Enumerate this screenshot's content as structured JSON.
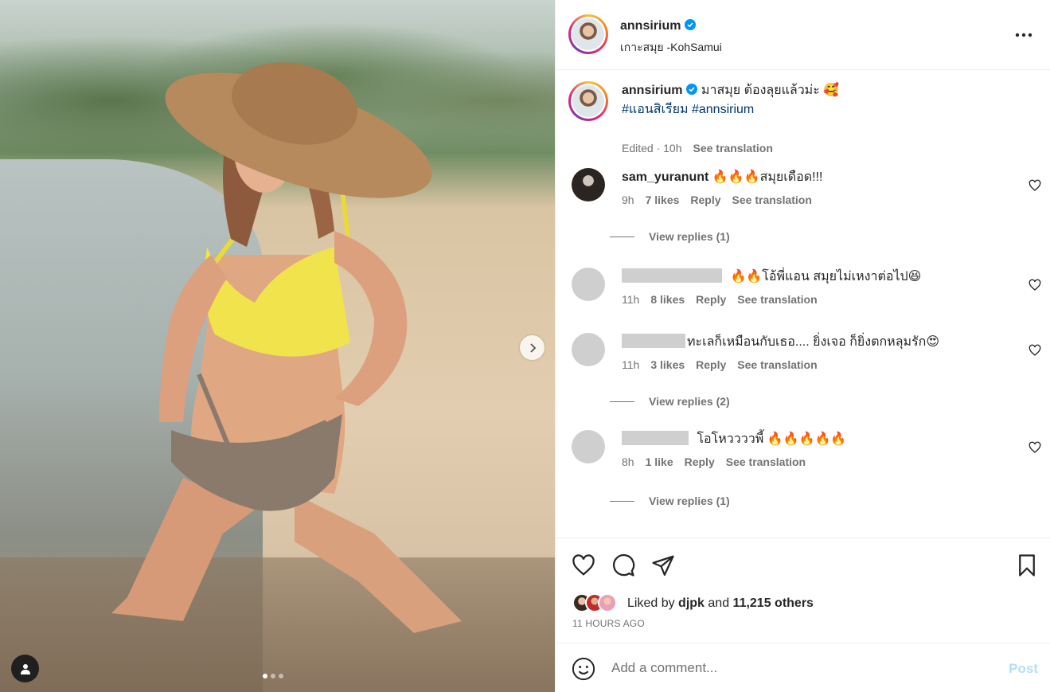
{
  "post": {
    "image_alt": "Woman in yellow bikini top and straw hat kneeling in shallow water on a beach",
    "carousel_dots": 3,
    "carousel_active": 0
  },
  "header": {
    "username": "annsirium",
    "location": "เกาะสมุย -KohSamui"
  },
  "caption": {
    "username": "annsirium",
    "text": "มาสมุย ต้องลุยแล้วม่ะ 🥰",
    "hashtag_1": "#แอนสิเรียม",
    "hashtag_2": "#annsirium",
    "edited": "Edited · 10h",
    "see_translation": "See translation"
  },
  "comments": [
    {
      "username": "sam_yuranunt",
      "text": "🔥🔥🔥สมุยเดือด!!!",
      "time": "9h",
      "likes": "7 likes",
      "reply": "Reply",
      "see_translation": "See translation",
      "view_replies": "View replies (1)"
    },
    {
      "username": "",
      "text": "🔥🔥โอ้พี่แอน สมุยไม่เหงาต่อไป😆",
      "time": "11h",
      "likes": "8 likes",
      "reply": "Reply",
      "see_translation": "See translation"
    },
    {
      "username": "",
      "text": "ทะเลก็เหมือนกับเธอ.... ยิ่งเจอ ก็ยิ่งตกหลุมรัก😍",
      "time": "11h",
      "likes": "3 likes",
      "reply": "Reply",
      "see_translation": "See translation",
      "view_replies": "View replies (2)"
    },
    {
      "username": "",
      "text": "โอโหววววพี้ 🔥🔥🔥🔥🔥",
      "time": "8h",
      "likes": "1 like",
      "reply": "Reply",
      "see_translation": "See translation",
      "view_replies": "View replies (1)"
    }
  ],
  "likes": {
    "prefix": "Liked by",
    "user": "djpk",
    "and": "and",
    "others": "11,215 others"
  },
  "timestamp": "11 HOURS AGO",
  "add_comment": {
    "placeholder": "Add a comment...",
    "post_label": "Post"
  },
  "icons": [
    "more-icon",
    "verified-icon",
    "heart-icon",
    "comment-icon",
    "share-icon",
    "bookmark-icon",
    "emoji-icon",
    "chevron-right-icon",
    "tagged-user-icon"
  ],
  "colors": {
    "link": "#00376b",
    "muted": "#737373",
    "verified": "#0095f6",
    "post_disabled": "#b2dffc"
  }
}
